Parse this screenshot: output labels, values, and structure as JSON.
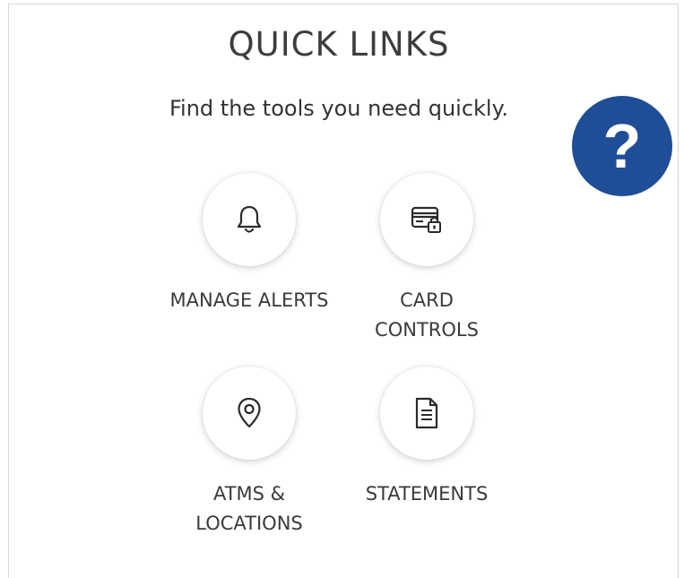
{
  "header": {
    "title": "QUICK LINKS",
    "subtitle": "Find the tools you need quickly."
  },
  "help_button": {
    "label": "?",
    "color": "#1f4e96"
  },
  "links": [
    {
      "icon": "bell-icon",
      "label_lines": [
        "MANAGE ALERTS"
      ]
    },
    {
      "icon": "card-lock-icon",
      "label_lines": [
        "CARD",
        "CONTROLS"
      ]
    },
    {
      "icon": "location-pin-icon",
      "label_lines": [
        "ATMS &",
        "LOCATIONS"
      ]
    },
    {
      "icon": "document-icon",
      "label_lines": [
        "STATEMENTS"
      ]
    }
  ]
}
